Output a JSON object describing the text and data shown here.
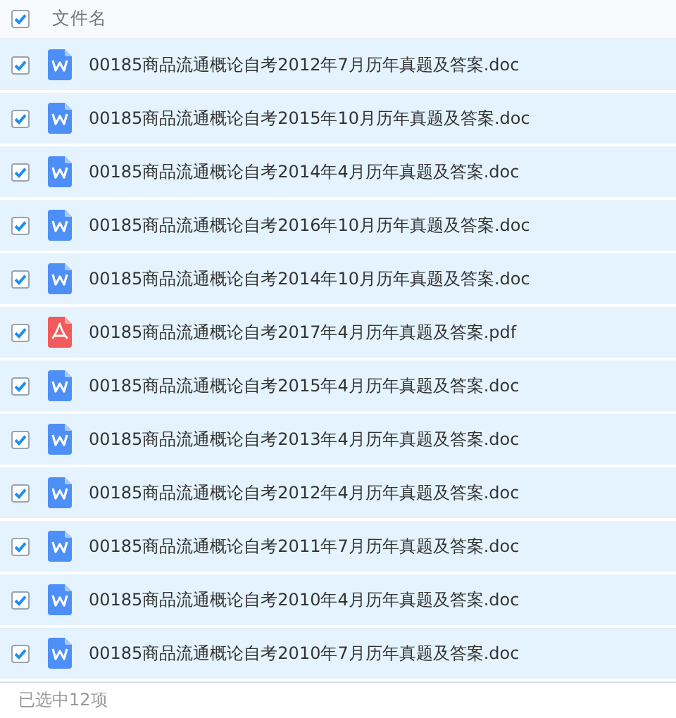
{
  "header": {
    "select_all_checked": true,
    "column_label": "文件名"
  },
  "files": [
    {
      "name": "00185商品流通概论自考2012年7月历年真题及答案.doc",
      "kind": "doc",
      "selected": true
    },
    {
      "name": "00185商品流通概论自考2015年10月历年真题及答案.doc",
      "kind": "doc",
      "selected": true
    },
    {
      "name": "00185商品流通概论自考2014年4月历年真题及答案.doc",
      "kind": "doc",
      "selected": true
    },
    {
      "name": "00185商品流通概论自考2016年10月历年真题及答案.doc",
      "kind": "doc",
      "selected": true
    },
    {
      "name": "00185商品流通概论自考2014年10月历年真题及答案.doc",
      "kind": "doc",
      "selected": true
    },
    {
      "name": "00185商品流通概论自考2017年4月历年真题及答案.pdf",
      "kind": "pdf",
      "selected": true
    },
    {
      "name": "00185商品流通概论自考2015年4月历年真题及答案.doc",
      "kind": "doc",
      "selected": true
    },
    {
      "name": "00185商品流通概论自考2013年4月历年真题及答案.doc",
      "kind": "doc",
      "selected": true
    },
    {
      "name": "00185商品流通概论自考2012年4月历年真题及答案.doc",
      "kind": "doc",
      "selected": true
    },
    {
      "name": "00185商品流通概论自考2011年7月历年真题及答案.doc",
      "kind": "doc",
      "selected": true
    },
    {
      "name": "00185商品流通概论自考2010年4月历年真题及答案.doc",
      "kind": "doc",
      "selected": true
    },
    {
      "name": "00185商品流通概论自考2010年7月历年真题及答案.doc",
      "kind": "doc",
      "selected": true
    }
  ],
  "status_bar": "已选中12项"
}
